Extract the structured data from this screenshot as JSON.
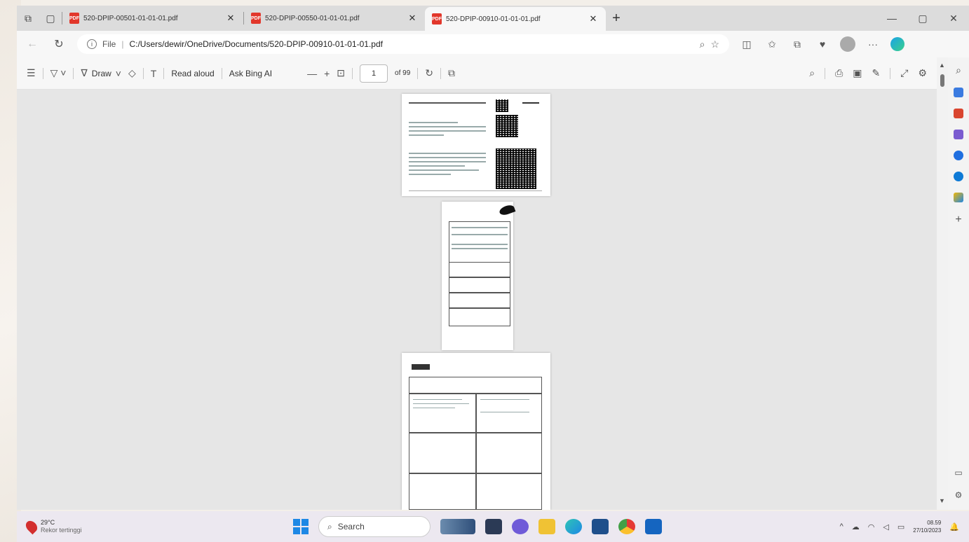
{
  "tabs": [
    {
      "title": "520-DPIP-00501-01-01-01.pdf",
      "active": false
    },
    {
      "title": "520-DPIP-00550-01-01-01.pdf",
      "active": false
    },
    {
      "title": "520-DPIP-00910-01-01-01.pdf",
      "active": true
    }
  ],
  "address": {
    "scheme": "File",
    "url": "C:/Users/dewir/OneDrive/Documents/520-DPIP-00910-01-01-01.pdf"
  },
  "pdf_toolbar": {
    "draw_label": "Draw",
    "read_aloud_label": "Read aloud",
    "ask_bing_label": "Ask Bing AI",
    "page_number": "1",
    "page_total": "of 99"
  },
  "weather": {
    "temp": "29°C",
    "description": "Rekor tertinggi"
  },
  "taskbar": {
    "search_placeholder": "Search"
  },
  "clock": {
    "time": "08.59",
    "date": "27/10/2023"
  }
}
